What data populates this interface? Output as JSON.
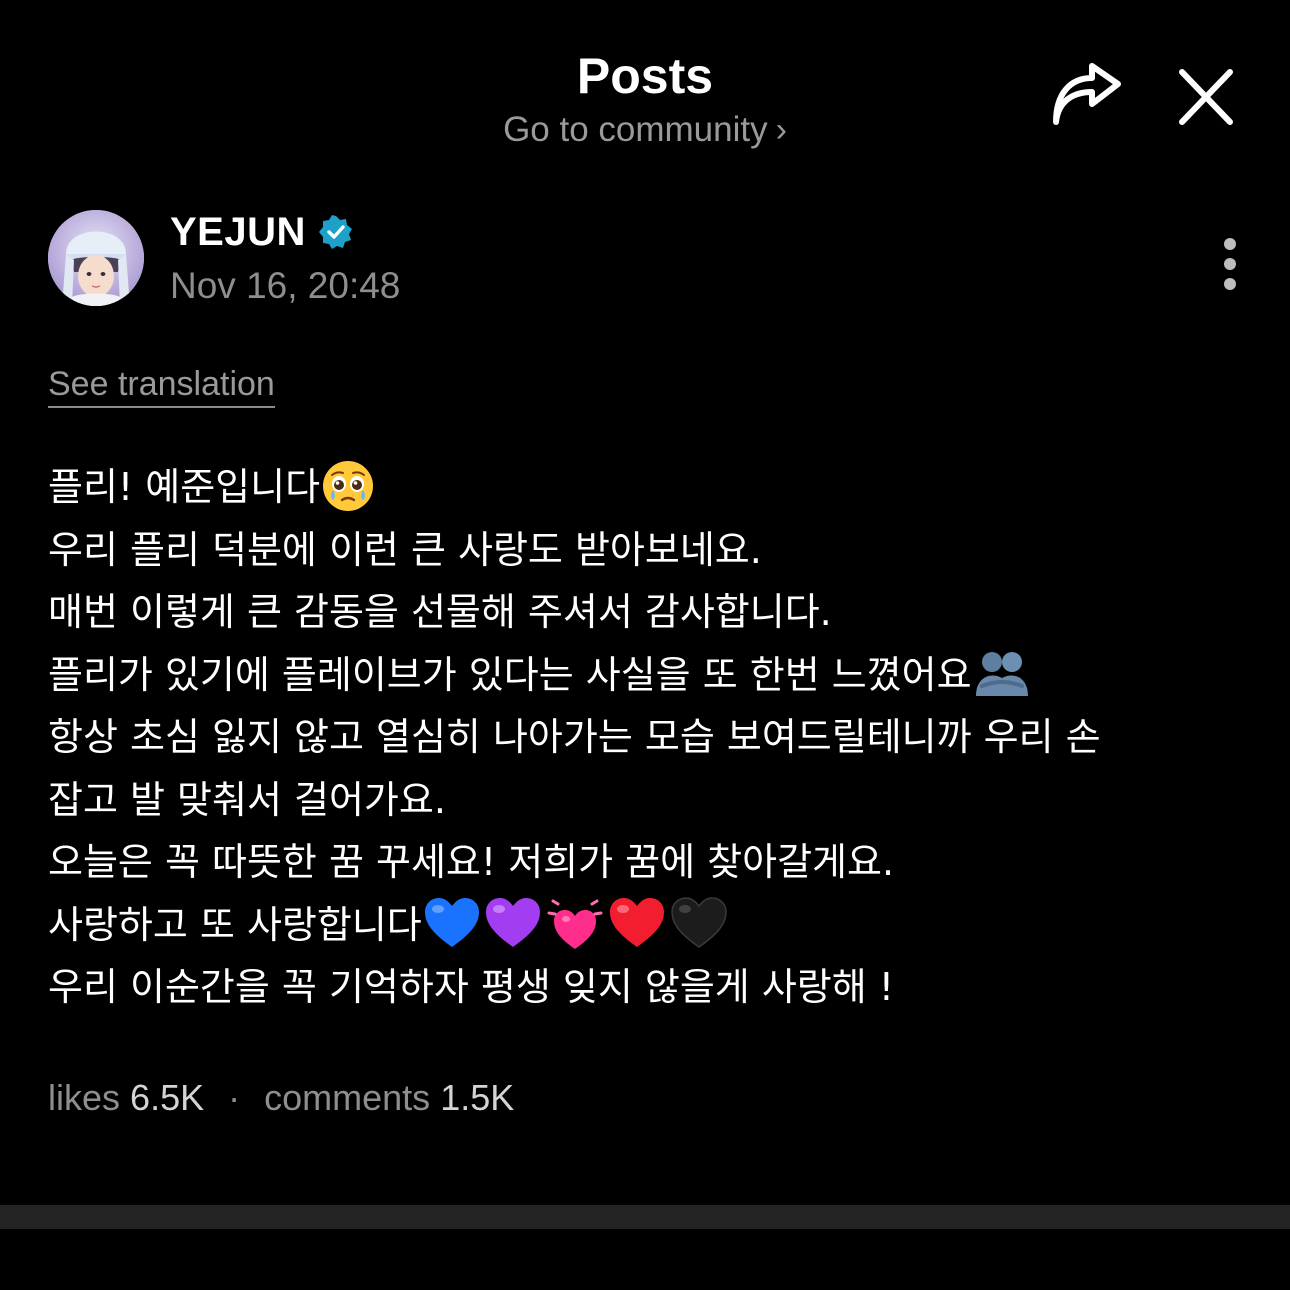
{
  "header": {
    "title": "Posts",
    "community_link": "Go to community",
    "community_chevron": "›",
    "share_icon": "share-arrow-icon",
    "close_icon": "close-icon"
  },
  "author": {
    "name": "YEJUN",
    "verified": true,
    "time": "Nov 16, 20:48",
    "avatar": "avatar-illustration",
    "menu_icon": "more-vertical-icon"
  },
  "see_translation": "See translation",
  "post": {
    "lines": [
      {
        "text": "플리! 예준입니다",
        "emojis": [
          "pleading-tear-face"
        ]
      },
      {
        "text": "우리 플리 덕분에 이런 큰 사랑도 받아보네요.",
        "emojis": []
      },
      {
        "text": "매번 이렇게 큰 감동을 선물해 주셔서 감사합니다.",
        "emojis": []
      },
      {
        "text": "플리가 있기에 플레이브가 있다는 사실을 또 한번 느꼈어요",
        "emojis": [
          "people-hugging"
        ]
      },
      {
        "text": "항상 초심 잃지 않고 열심히 나아가는 모습 보여드릴테니까 우리 손",
        "emojis": []
      },
      {
        "text": "잡고 발 맞춰서 걸어가요.",
        "emojis": []
      },
      {
        "text": "오늘은 꼭 따뜻한 꿈 꾸세요! 저희가 꿈에 찾아갈게요.",
        "emojis": []
      },
      {
        "text": "사랑하고 또 사랑합니다",
        "emojis": [
          "blue-heart",
          "purple-heart",
          "two-hearts",
          "red-heart",
          "black-heart"
        ]
      },
      {
        "text": "우리 이순간을 꼭 기억하자 평생 잊지 않을게 사랑해 !",
        "emojis": []
      }
    ]
  },
  "stats": {
    "likes_label": "likes",
    "likes_value": "6.5K",
    "separator": "·",
    "comments_label": "comments",
    "comments_value": "1.5K"
  },
  "colors": {
    "background": "#000000",
    "verified_badge": "#1da1c8",
    "muted_text": "#8e8e8e",
    "bottom_bar": "#232323"
  }
}
